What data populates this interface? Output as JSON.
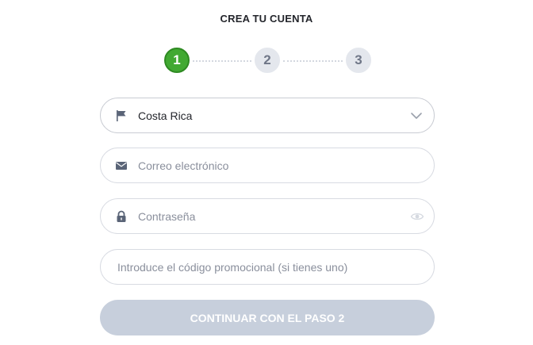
{
  "header": {
    "title": "CREA TU CUENTA"
  },
  "stepper": {
    "current_step": 1,
    "steps": [
      {
        "label": "1",
        "state": "active"
      },
      {
        "label": "2",
        "state": "inactive"
      },
      {
        "label": "3",
        "state": "inactive"
      }
    ]
  },
  "form": {
    "country": {
      "value": "Costa Rica",
      "icon": "flag-icon",
      "trailing_icon": "chevron-down-icon"
    },
    "email": {
      "placeholder": "Correo electrónico",
      "icon": "envelope-icon"
    },
    "password": {
      "placeholder": "Contraseña",
      "icon": "lock-icon",
      "trailing_icon": "eye-icon"
    },
    "promo": {
      "placeholder": "Introduce el código promocional (si tienes uno)"
    },
    "submit_label": "CONTINUAR CON EL PASO 2"
  },
  "colors": {
    "active_step": "#41a932",
    "inactive_step": "#e4e7ed",
    "icon": "#5a6477",
    "button_disabled": "#c7cfdc"
  }
}
